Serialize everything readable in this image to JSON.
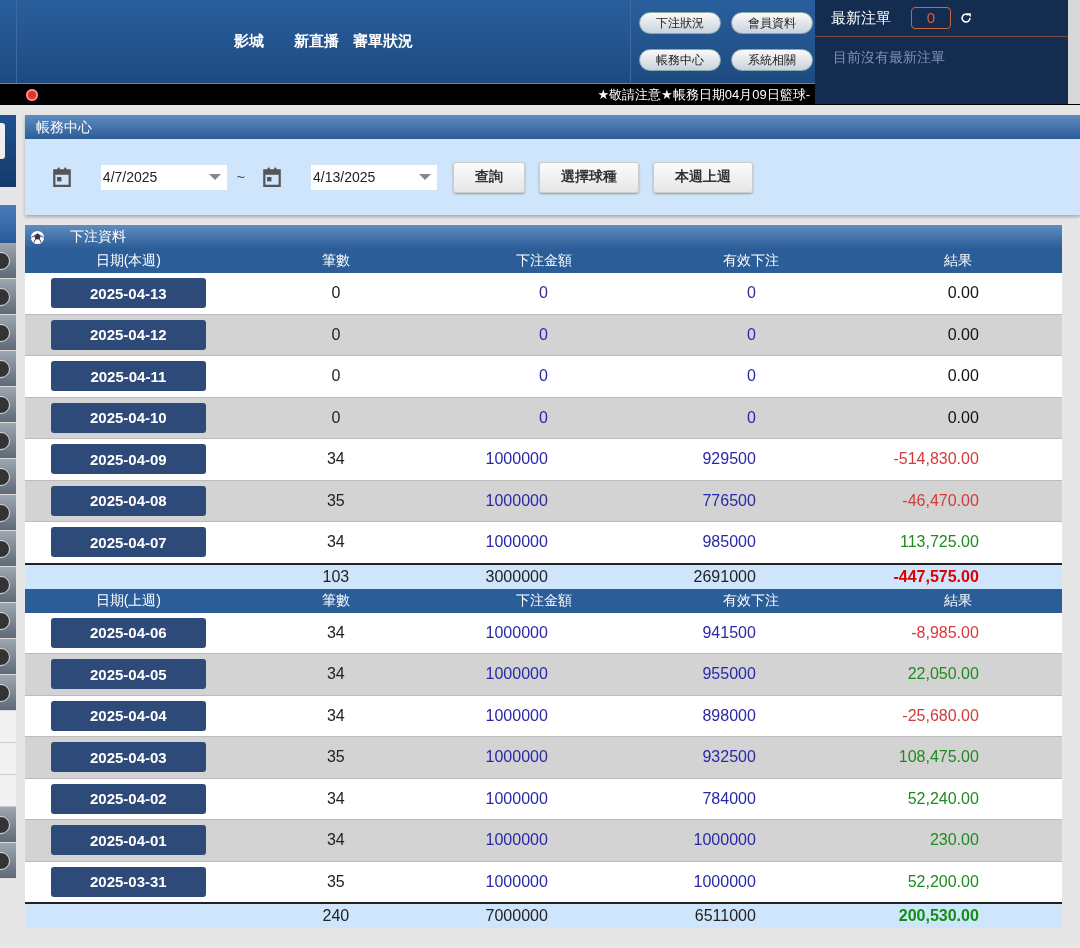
{
  "header": {
    "nav": [
      "影城",
      "新直播",
      "審單狀況"
    ],
    "buttons": [
      "下注狀況",
      "會員資料",
      "帳務中心",
      "系統相關"
    ],
    "ticker": "★敬請注意★帳務日期04月09日籃球-"
  },
  "latest_orders": {
    "title": "最新注單",
    "count": "0",
    "empty_text": "目前沒有最新注單"
  },
  "account_center": {
    "title": "帳務中心",
    "date_from": "4/7/2025",
    "separator": "~",
    "date_to": "4/13/2025",
    "buttons": [
      "查詢",
      "選擇球種",
      "本週上週"
    ]
  },
  "bets": {
    "title": "下注資料",
    "weeks": [
      {
        "columns": [
          "日期(本週)",
          "筆數",
          "下注金額",
          "有效下注",
          "結果"
        ],
        "rows": [
          {
            "date": "2025-04-13",
            "count": "0",
            "amount": "0",
            "valid": "0",
            "result": "0.00",
            "color": "#111111"
          },
          {
            "date": "2025-04-12",
            "count": "0",
            "amount": "0",
            "valid": "0",
            "result": "0.00",
            "color": "#111111"
          },
          {
            "date": "2025-04-11",
            "count": "0",
            "amount": "0",
            "valid": "0",
            "result": "0.00",
            "color": "#111111"
          },
          {
            "date": "2025-04-10",
            "count": "0",
            "amount": "0",
            "valid": "0",
            "result": "0.00",
            "color": "#111111"
          },
          {
            "date": "2025-04-09",
            "count": "34",
            "amount": "1000000",
            "valid": "929500",
            "result": "-514,830.00",
            "color": "#d33a3a"
          },
          {
            "date": "2025-04-08",
            "count": "35",
            "amount": "1000000",
            "valid": "776500",
            "result": "-46,470.00",
            "color": "#d33a3a"
          },
          {
            "date": "2025-04-07",
            "count": "34",
            "amount": "1000000",
            "valid": "985000",
            "result": "113,725.00",
            "color": "#1f8a1f"
          }
        ],
        "total": {
          "count": "103",
          "amount": "3000000",
          "valid": "2691000",
          "result": "-447,575.00",
          "color": "#e00000"
        }
      },
      {
        "columns": [
          "日期(上週)",
          "筆數",
          "下注金額",
          "有效下注",
          "結果"
        ],
        "rows": [
          {
            "date": "2025-04-06",
            "count": "34",
            "amount": "1000000",
            "valid": "941500",
            "result": "-8,985.00",
            "color": "#d33a3a"
          },
          {
            "date": "2025-04-05",
            "count": "34",
            "amount": "1000000",
            "valid": "955000",
            "result": "22,050.00",
            "color": "#1f8a1f"
          },
          {
            "date": "2025-04-04",
            "count": "34",
            "amount": "1000000",
            "valid": "898000",
            "result": "-25,680.00",
            "color": "#d33a3a"
          },
          {
            "date": "2025-04-03",
            "count": "35",
            "amount": "1000000",
            "valid": "932500",
            "result": "108,475.00",
            "color": "#1f8a1f"
          },
          {
            "date": "2025-04-02",
            "count": "34",
            "amount": "1000000",
            "valid": "784000",
            "result": "52,240.00",
            "color": "#1f8a1f"
          },
          {
            "date": "2025-04-01",
            "count": "34",
            "amount": "1000000",
            "valid": "1000000",
            "result": "230.00",
            "color": "#1f8a1f"
          },
          {
            "date": "2025-03-31",
            "count": "35",
            "amount": "1000000",
            "valid": "1000000",
            "result": "52,200.00",
            "color": "#1f8a1f"
          }
        ],
        "total": {
          "count": "240",
          "amount": "7000000",
          "valid": "6511000",
          "result": "200,530.00",
          "color": "#109010"
        }
      }
    ]
  }
}
